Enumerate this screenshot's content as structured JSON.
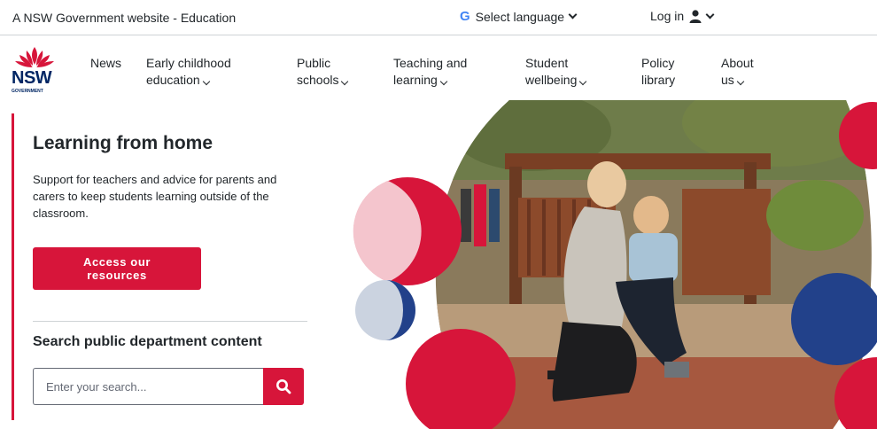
{
  "utility": {
    "gov_text": "A NSW Government website - Education",
    "language_label": "Select language",
    "login_label": "Log in"
  },
  "logo": {
    "text": "NSW",
    "sub": "GOVERNMENT"
  },
  "nav": {
    "items": [
      {
        "line1": "News",
        "line2": ""
      },
      {
        "line1": "Early childhood",
        "line2": "education"
      },
      {
        "line1": "Public",
        "line2": "schools"
      },
      {
        "line1": "Teaching and",
        "line2": "learning"
      },
      {
        "line1": "Student",
        "line2": "wellbeing"
      },
      {
        "line1": "Policy",
        "line2": "library"
      },
      {
        "line1": "About",
        "line2": "us"
      }
    ]
  },
  "hero": {
    "title": "Learning from home",
    "description": "Support for teachers and advice for parents and carers to keep students learning outside of the classroom.",
    "cta_line1": "Access our",
    "cta_line2": "resources"
  },
  "search": {
    "title": "Search public department content",
    "placeholder": "Enter your search..."
  },
  "colors": {
    "brand_red": "#d7153a",
    "brand_navy": "#002664",
    "pale_pink": "#f4c5cd",
    "pale_blue": "#cbd3e0",
    "mid_blue": "#22418a"
  }
}
